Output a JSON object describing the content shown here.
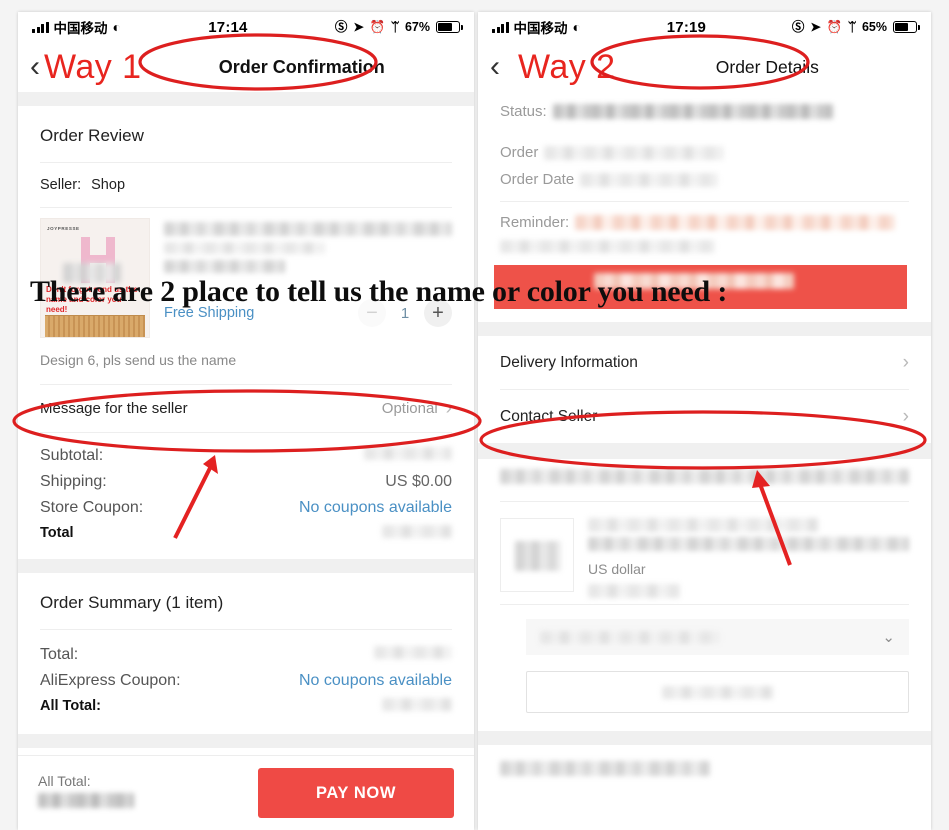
{
  "annotation": {
    "overlay_text": "There are 2 place to tell us the name or color you need :",
    "way1_label": "Way 1",
    "way2_label": "Way 2",
    "accent_red": "#e8251f",
    "circle_color": "#dd1f1f",
    "arrow_color": "#e42222"
  },
  "left_phone": {
    "status": {
      "carrier": "中国移动",
      "time": "17:14",
      "battery_percent": "67%",
      "wifi_icon": "wifi-icon",
      "signal_icon": "signal-bars-icon",
      "lock_rotation_icon": "rotation-lock-icon",
      "location_icon": "location-arrow-icon",
      "alarm_icon": "alarm-clock-icon",
      "bluetooth_icon": "bluetooth-icon",
      "battery_icon": "battery-icon"
    },
    "nav": {
      "back_icon": "chevron-left-icon",
      "title": "Order Confirmation"
    },
    "order_review": {
      "heading": "Order Review",
      "seller_label": "Seller:",
      "seller_name": "Shop",
      "thumbnail": {
        "brand": "JOYPRESSE",
        "caption": "Don't forget send us the name and color you need!"
      },
      "free_shipping": "Free Shipping",
      "quantity": "1",
      "minus_icon": "minus-icon",
      "plus_icon": "plus-icon",
      "variant_note": "Design 6, pls send us the name"
    },
    "message_row": {
      "label": "Message for the seller",
      "value": "Optional",
      "chevron_icon": "chevron-right-icon"
    },
    "price_rows": [
      {
        "label": "Subtotal:",
        "value": "",
        "blurred": true
      },
      {
        "label": "Shipping:",
        "value": "US $0.00",
        "blurred": false
      },
      {
        "label": "Store Coupon:",
        "value": "No coupons available",
        "blurred": false,
        "link": true
      },
      {
        "label": "Total",
        "value": "",
        "blurred": true,
        "bold": true
      }
    ],
    "order_summary": {
      "heading": "Order Summary (1 item)",
      "rows": [
        {
          "label": "Total:",
          "value": "",
          "blurred": true
        },
        {
          "label": "AliExpress Coupon:",
          "value": "No coupons available",
          "blurred": false,
          "link": true
        },
        {
          "label": "All Total:",
          "value": "",
          "blurred": true,
          "bold": true
        }
      ]
    },
    "paybar": {
      "total_label": "All Total:",
      "pay_button": "PAY NOW"
    }
  },
  "right_phone": {
    "status": {
      "carrier": "中国移动",
      "time": "17:19",
      "battery_percent": "65%"
    },
    "nav": {
      "back_icon": "chevron-left-icon",
      "title": "Order Details"
    },
    "order_info": [
      {
        "label": "Status:",
        "blurred": true
      },
      {
        "label": "Order",
        "blurred": true
      },
      {
        "label": "Order Date",
        "blurred": true
      }
    ],
    "reminder": {
      "label": "Reminder:",
      "blurred": true
    },
    "nav_rows": [
      {
        "label": "Delivery Information",
        "chevron_icon": "chevron-right-icon"
      },
      {
        "label": "Contact Seller",
        "chevron_icon": "chevron-right-icon"
      }
    ],
    "product": {
      "currency_note": "US dollar",
      "dropdown_icon": "chevron-down-icon"
    }
  }
}
